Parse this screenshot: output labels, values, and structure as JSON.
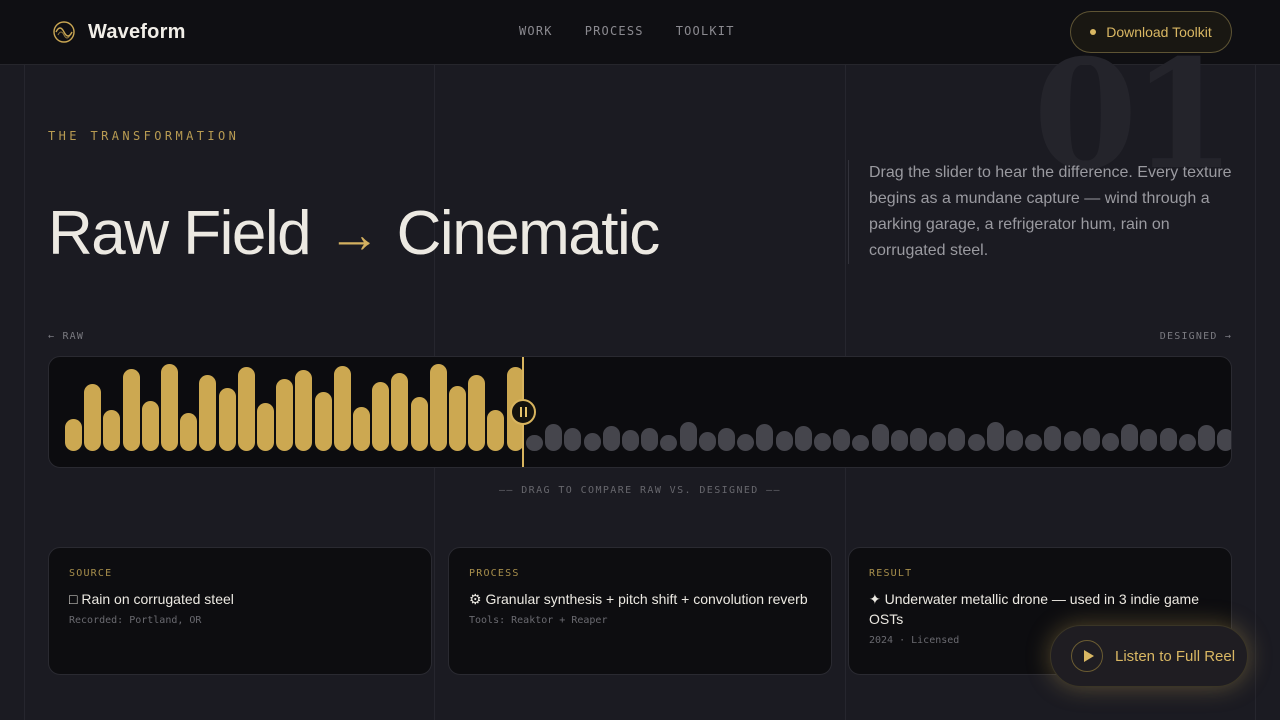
{
  "brand": {
    "name": "Waveform"
  },
  "nav": [
    "WORK",
    "PROCESS",
    "TOOLKIT"
  ],
  "download_button": "Download Toolkit",
  "section_number": "01",
  "eyebrow": "THE TRANSFORMATION",
  "headline": {
    "left": "Raw Field",
    "arrow": "→",
    "right": "Cinematic"
  },
  "description": "Drag the slider to hear the difference. Every texture begins as a mundane capture — wind through a parking garage, a refrigerator hum, rain on corrugated steel.",
  "waveform": {
    "raw_label": "← RAW",
    "designed_label": "DESIGNED →",
    "raw_levels": [
      0.36,
      0.74,
      0.45,
      0.91,
      0.56,
      0.97,
      0.42,
      0.84,
      0.7,
      0.93,
      0.53,
      0.8,
      0.9,
      0.66,
      0.94,
      0.49,
      0.77,
      0.87,
      0.6,
      0.97,
      0.72,
      0.84,
      0.46,
      0.93
    ],
    "designed_levels": [
      0.18,
      0.3,
      0.25,
      0.2,
      0.28,
      0.23,
      0.25,
      0.18,
      0.32,
      0.21,
      0.25,
      0.19,
      0.3,
      0.22,
      0.28,
      0.2,
      0.24,
      0.18,
      0.3,
      0.23,
      0.26,
      0.21,
      0.25,
      0.19,
      0.32,
      0.23,
      0.19,
      0.28,
      0.22,
      0.26,
      0.2,
      0.3,
      0.24,
      0.26,
      0.19,
      0.29,
      0.24,
      0.21,
      0.27,
      0.23
    ],
    "slider_position": 0.4,
    "hint": "—— DRAG TO COMPARE RAW VS. DESIGNED ——"
  },
  "cards": [
    {
      "tag": "SOURCE",
      "title": "□ Rain on corrugated steel",
      "meta": "Recorded: Portland, OR"
    },
    {
      "tag": "PROCESS",
      "title": "⚙ Granular synthesis + pitch shift + convolution reverb",
      "meta": "Tools: Reaktor + Reaper"
    },
    {
      "tag": "RESULT",
      "title": "✦ Underwater metallic drone — used in 3 indie game OSTs",
      "meta": "2024 · Licensed"
    }
  ],
  "listen_button": "Listen to Full Reel",
  "colors": {
    "accent": "#d8b45e",
    "background": "#1b1b22",
    "panel": "#0c0c0f"
  }
}
